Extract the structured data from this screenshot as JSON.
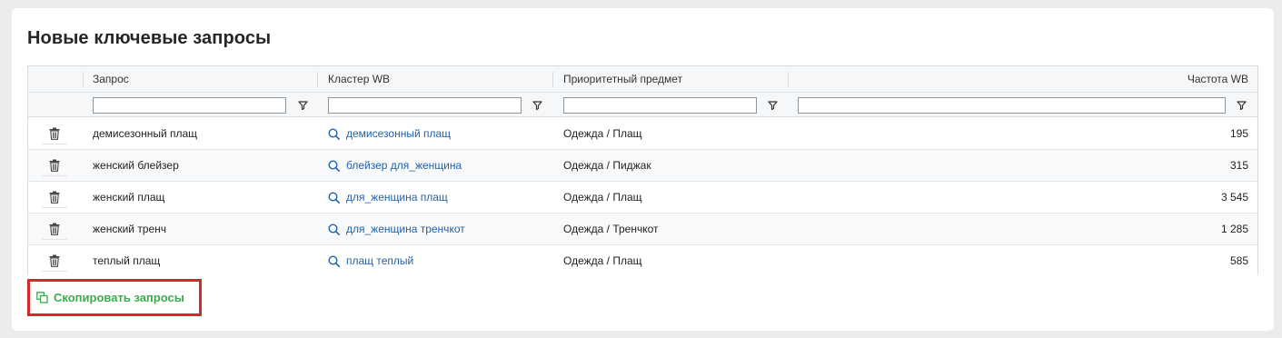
{
  "card": {
    "title": "Новые ключевые запросы"
  },
  "table": {
    "columns": [
      "Запрос",
      "Кластер WB",
      "Приоритетный предмет",
      "Частота WB"
    ],
    "rows": [
      {
        "query": "демисезонный плащ",
        "cluster": "демисезонный плащ",
        "subject": "Одежда / Плащ",
        "frequency": "195"
      },
      {
        "query": "женский блейзер",
        "cluster": "блейзер для_женщина",
        "subject": "Одежда / Пиджак",
        "frequency": "315"
      },
      {
        "query": "женский плащ",
        "cluster": "для_женщина плащ",
        "subject": "Одежда / Плащ",
        "frequency": "3 545"
      },
      {
        "query": "женский тренч",
        "cluster": "для_женщина тренчкот",
        "subject": "Одежда / Тренчкот",
        "frequency": "1 285"
      },
      {
        "query": "теплый плащ",
        "cluster": "плащ теплый",
        "subject": "Одежда / Плащ",
        "frequency": "585"
      }
    ]
  },
  "actions": {
    "copy_label": "Скопировать запросы"
  },
  "icons": {
    "delete": "trash-icon",
    "cluster": "search-icon",
    "filter": "filter-icon",
    "copy": "copy-icon"
  },
  "colors": {
    "link": "#2262a8",
    "accent_green": "#3cab4f",
    "highlight_red": "#d6282b"
  }
}
